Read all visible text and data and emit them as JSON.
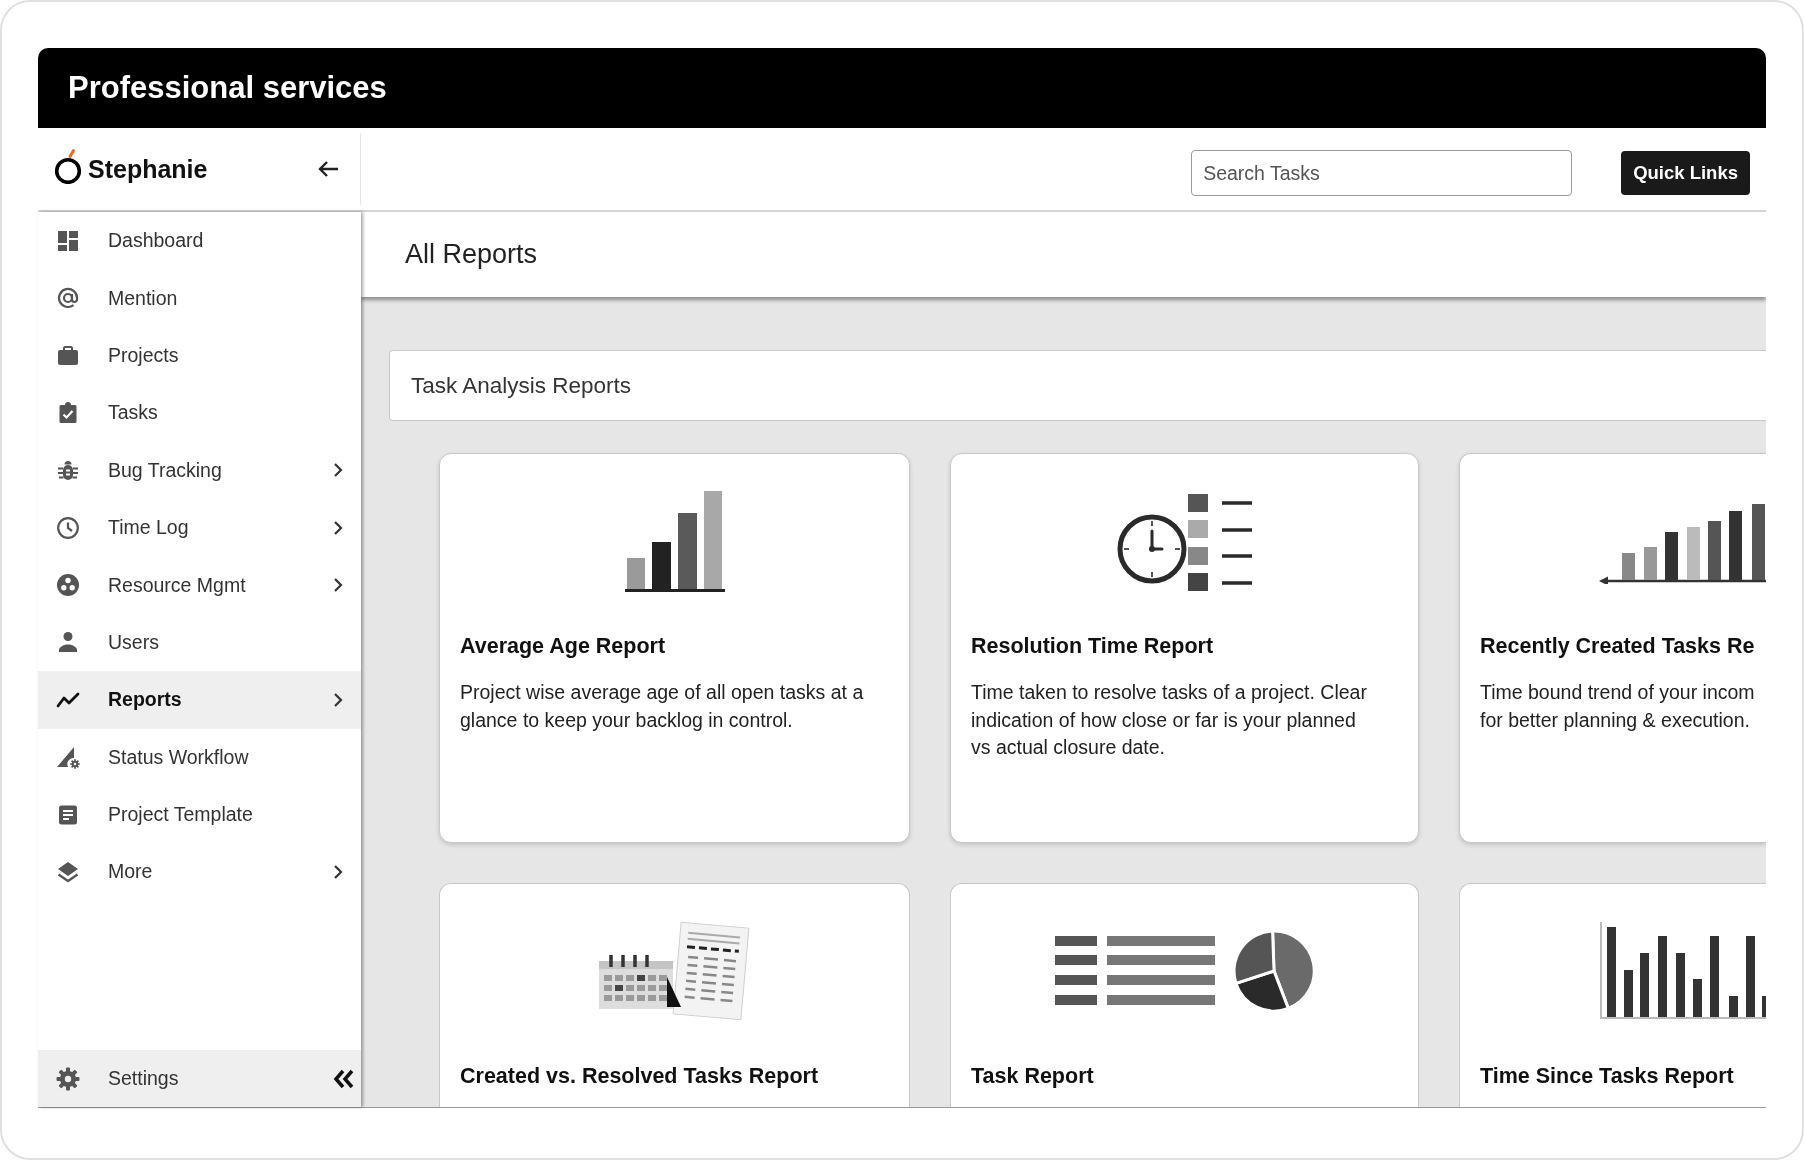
{
  "window": {
    "title": "Professional services"
  },
  "sidebar": {
    "brand": "Stephanie",
    "items": [
      {
        "label": "Dashboard",
        "has_submenu": false,
        "selected": false
      },
      {
        "label": "Mention",
        "has_submenu": false,
        "selected": false
      },
      {
        "label": "Projects",
        "has_submenu": false,
        "selected": false
      },
      {
        "label": "Tasks",
        "has_submenu": false,
        "selected": false
      },
      {
        "label": "Bug Tracking",
        "has_submenu": true,
        "selected": false
      },
      {
        "label": "Time Log",
        "has_submenu": true,
        "selected": false
      },
      {
        "label": "Resource Mgmt",
        "has_submenu": true,
        "selected": false
      },
      {
        "label": "Users",
        "has_submenu": false,
        "selected": false
      },
      {
        "label": "Reports",
        "has_submenu": true,
        "selected": true
      },
      {
        "label": "Status Workflow",
        "has_submenu": false,
        "selected": false
      },
      {
        "label": "Project Template",
        "has_submenu": false,
        "selected": false
      },
      {
        "label": "More",
        "has_submenu": true,
        "selected": false
      }
    ],
    "footer": {
      "label": "Settings"
    }
  },
  "header": {
    "search": {
      "placeholder": "Search Tasks"
    },
    "quick_links": "Quick Links"
  },
  "page": {
    "title": "All Reports",
    "section": "Task Analysis Reports"
  },
  "reports": [
    {
      "title": "Average Age Report",
      "description": "Project wise average age of all open tasks at a\nglance to keep your backlog in control."
    },
    {
      "title": "Resolution Time Report",
      "description": "Time taken to resolve tasks of a project. Clear\nindication of how close or far is your planned\nvs actual closure date."
    },
    {
      "title": "Recently Created Tasks Re",
      "description": "Time bound trend of your incom\nfor better planning & execution."
    },
    {
      "title": "Created vs. Resolved Tasks Report"
    },
    {
      "title": "Task Report"
    },
    {
      "title": "Time Since Tasks Report"
    }
  ]
}
